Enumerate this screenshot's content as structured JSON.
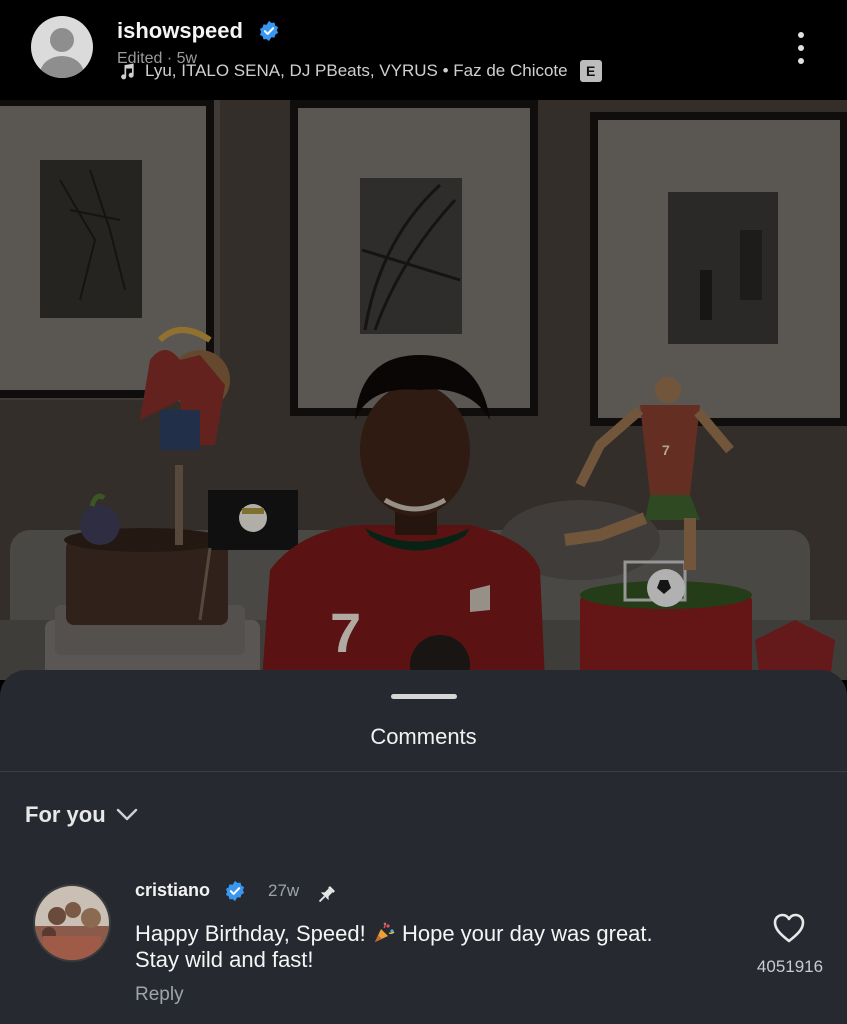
{
  "post": {
    "username": "ishowspeed",
    "edited_label": "Edited · 5w",
    "music": "Lyu, ITALO SENA, DJ PBeats, VYRUS • Faz de Chicote",
    "explicit_badge": "E",
    "icons": [
      "person-icon",
      "verified-badge-icon",
      "music-note-icon",
      "more-vertical-icon"
    ]
  },
  "photo": {
    "jersey_number": "7",
    "cake_figure_number": "7"
  },
  "comments_sheet": {
    "title": "Comments",
    "filter": "For you",
    "filter_icon": "chevron-down-icon",
    "comments": [
      {
        "username": "cristiano",
        "time": "27w",
        "pinned": true,
        "text_line1_a": "Happy Birthday, Speed! ",
        "text_line1_b": " Hope your day was great.",
        "text_line2": "Stay wild and fast!",
        "emoji": "party-popper-icon",
        "reply_label": "Reply",
        "likes": "4051916"
      }
    ]
  },
  "colors": {
    "header_bg": "#000000",
    "sheet_bg": "#262a30",
    "verified_blue": "#3897f0",
    "secondary_text": "#9ea4ab"
  }
}
